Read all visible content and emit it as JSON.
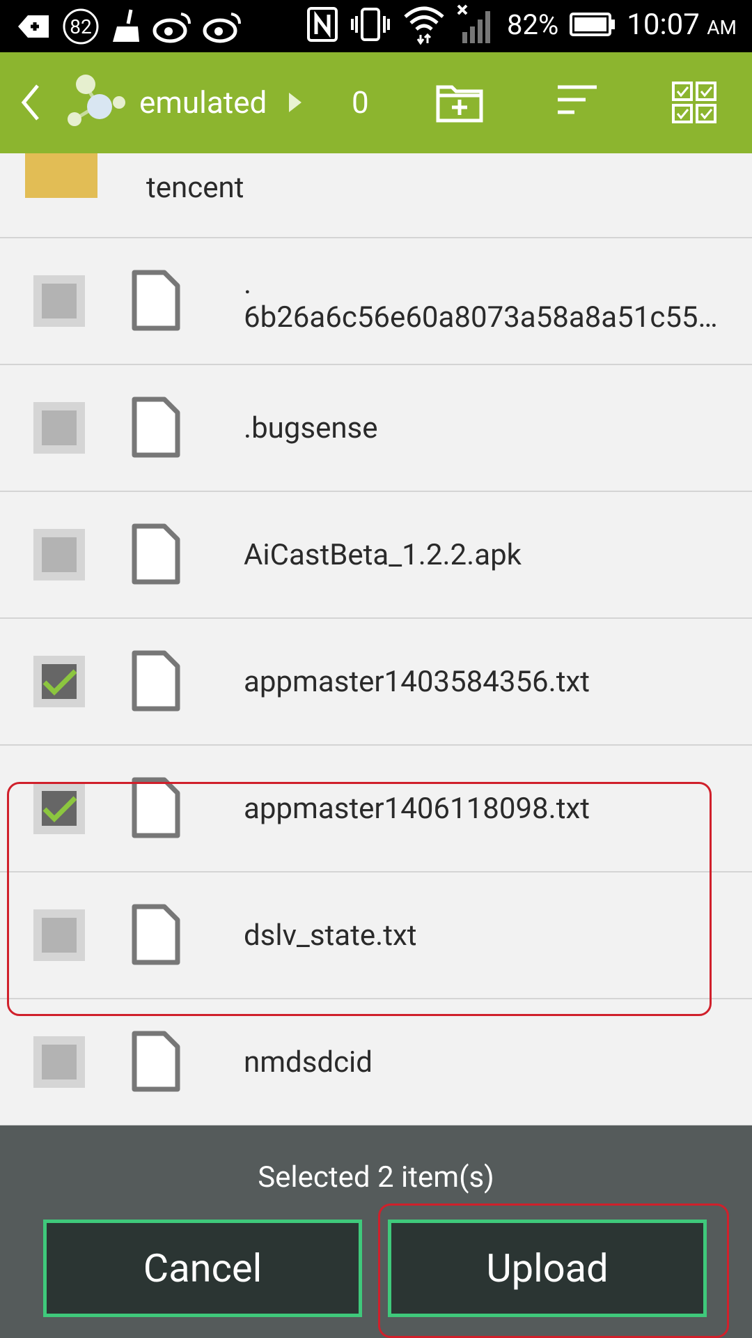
{
  "status_bar": {
    "notification_count": "82",
    "battery_percent": "82%",
    "time": "10:07",
    "time_suffix": "AM"
  },
  "toolbar": {
    "path_label": "emulated",
    "item_count": "0"
  },
  "list": {
    "folder_name": "tencent",
    "files": [
      {
        "line1": ".",
        "line2": "6b26a6c56e60a8073a58a8a51c55…",
        "checked": false
      },
      {
        "line1": ".bugsense",
        "checked": false
      },
      {
        "line1": "AiCastBeta_1.2.2.apk",
        "checked": false
      },
      {
        "line1": "appmaster1403584356.txt",
        "checked": true
      },
      {
        "line1": "appmaster1406118098.txt",
        "checked": true
      },
      {
        "line1": "dslv_state.txt",
        "checked": false
      },
      {
        "line1": "nmdsdcid",
        "checked": false
      }
    ]
  },
  "bottom_bar": {
    "status_text": "Selected 2 item(s)",
    "cancel_label": "Cancel",
    "upload_label": "Upload"
  },
  "colors": {
    "toolbar": "#8cb52f",
    "check": "#8cc63f",
    "highlight": "#d0202b",
    "button_border": "#3fc97b"
  }
}
